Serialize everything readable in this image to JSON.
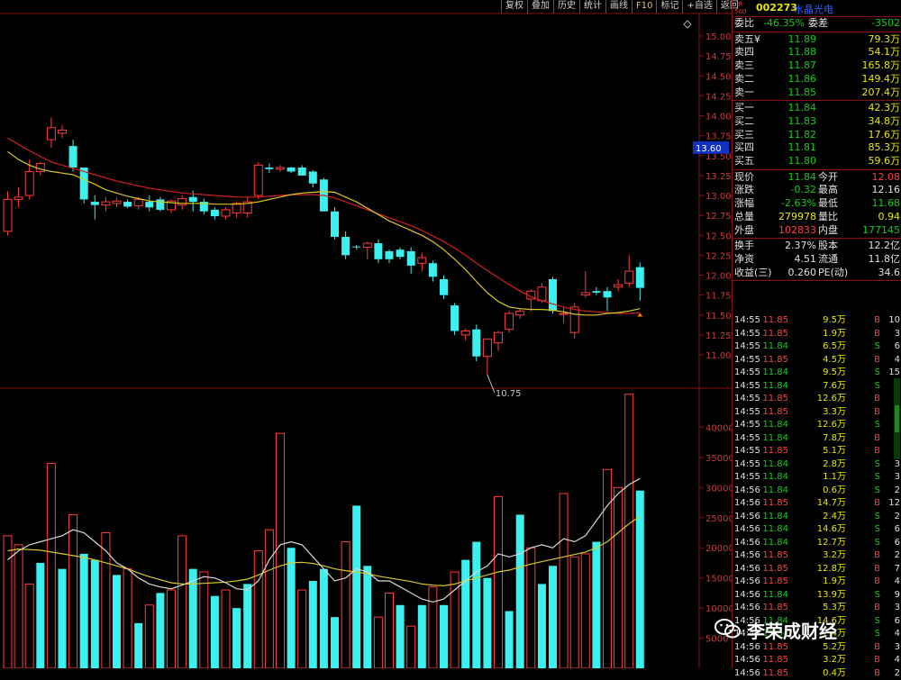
{
  "toolbar": {
    "items": [
      "复权",
      "叠加",
      "历史",
      "统计",
      "画线",
      "F10",
      "标记",
      "+自选",
      "返回"
    ]
  },
  "stock": {
    "code": "002273",
    "name": "水晶光电",
    "badge_top": "R",
    "badge_bottom": "500"
  },
  "price_axis": {
    "ticks": [
      "15.00",
      "14.75",
      "14.50",
      "14.25",
      "14.00",
      "13.75",
      "13.50",
      "13.25",
      "13.00",
      "12.75",
      "12.50",
      "12.25",
      "12.00",
      "11.75",
      "11.50",
      "11.25",
      "11.00"
    ],
    "marker": "13.60",
    "low_label": "10.75"
  },
  "volume_axis": {
    "ticks": [
      "40000",
      "35000",
      "30000",
      "25000",
      "20000",
      "15000",
      "10000",
      "5000"
    ]
  },
  "chart_data": [
    {
      "type": "candlestick",
      "title": "",
      "ylim": [
        10.6,
        15.15
      ],
      "ohlc": [
        [
          12.55,
          13.05,
          12.5,
          12.95
        ],
        [
          12.95,
          13.1,
          12.85,
          12.98
        ],
        [
          13.0,
          13.45,
          12.95,
          13.3
        ],
        [
          13.3,
          13.42,
          13.25,
          13.4
        ],
        [
          13.7,
          13.98,
          13.6,
          13.85
        ],
        [
          13.78,
          13.88,
          13.72,
          13.82
        ],
        [
          13.62,
          13.7,
          13.3,
          13.35
        ],
        [
          13.35,
          13.35,
          12.9,
          12.95
        ],
        [
          12.92,
          13.0,
          12.7,
          12.88
        ],
        [
          12.88,
          12.98,
          12.8,
          12.92
        ],
        [
          12.9,
          12.97,
          12.85,
          12.93
        ],
        [
          12.92,
          12.95,
          12.84,
          12.86
        ],
        [
          12.87,
          12.98,
          12.82,
          12.95
        ],
        [
          12.92,
          13.0,
          12.8,
          12.85
        ],
        [
          12.95,
          12.98,
          12.8,
          12.82
        ],
        [
          12.82,
          12.95,
          12.78,
          12.93
        ],
        [
          12.88,
          13.0,
          12.82,
          12.96
        ],
        [
          12.98,
          13.06,
          12.8,
          12.92
        ],
        [
          12.92,
          12.96,
          12.76,
          12.8
        ],
        [
          12.82,
          12.85,
          12.7,
          12.74
        ],
        [
          12.74,
          12.85,
          12.7,
          12.82
        ],
        [
          12.78,
          12.92,
          12.72,
          12.9
        ],
        [
          12.78,
          12.98,
          12.72,
          12.92
        ],
        [
          13.0,
          13.42,
          12.95,
          13.38
        ],
        [
          13.35,
          13.4,
          13.28,
          13.33
        ],
        [
          13.33,
          13.38,
          13.3,
          13.35
        ],
        [
          13.35,
          13.36,
          13.28,
          13.3
        ],
        [
          13.35,
          13.38,
          13.25,
          13.25
        ],
        [
          13.3,
          13.32,
          13.1,
          13.15
        ],
        [
          13.2,
          13.22,
          12.8,
          12.8
        ],
        [
          12.8,
          12.85,
          12.45,
          12.48
        ],
        [
          12.48,
          12.55,
          12.2,
          12.25
        ],
        [
          12.36,
          12.38,
          12.32,
          12.35
        ],
        [
          12.35,
          12.42,
          12.2,
          12.4
        ],
        [
          12.4,
          12.45,
          12.15,
          12.2
        ],
        [
          12.3,
          12.32,
          12.15,
          12.2
        ],
        [
          12.32,
          12.35,
          12.2,
          12.23
        ],
        [
          12.3,
          12.35,
          12.02,
          12.12
        ],
        [
          12.15,
          12.28,
          12.05,
          12.22
        ],
        [
          12.15,
          12.18,
          11.92,
          11.98
        ],
        [
          11.95,
          12.0,
          11.7,
          11.75
        ],
        [
          11.62,
          11.65,
          11.25,
          11.3
        ],
        [
          11.25,
          11.33,
          11.18,
          11.3
        ],
        [
          11.32,
          11.38,
          10.92,
          10.98
        ],
        [
          10.98,
          11.2,
          10.75,
          11.2
        ],
        [
          11.15,
          11.3,
          11.05,
          11.28
        ],
        [
          11.32,
          11.55,
          11.28,
          11.52
        ],
        [
          11.5,
          11.58,
          11.45,
          11.55
        ],
        [
          11.7,
          11.82,
          11.55,
          11.8
        ],
        [
          11.68,
          11.9,
          11.65,
          11.85
        ],
        [
          11.95,
          11.98,
          11.52,
          11.55
        ],
        [
          11.52,
          11.6,
          11.4,
          11.52
        ],
        [
          11.28,
          11.65,
          11.2,
          11.6
        ],
        [
          11.75,
          12.05,
          11.72,
          11.78
        ],
        [
          11.8,
          11.85,
          11.75,
          11.78
        ],
        [
          11.8,
          11.85,
          11.55,
          11.72
        ],
        [
          11.85,
          11.95,
          11.8,
          11.88
        ],
        [
          11.9,
          12.25,
          11.85,
          12.05
        ],
        [
          12.1,
          12.16,
          11.68,
          11.84
        ]
      ],
      "ma_short": [
        13.55,
        13.45,
        13.38,
        13.33,
        13.3,
        13.28,
        13.26,
        13.2,
        13.14,
        13.07,
        13.03,
        12.99,
        12.96,
        12.93,
        12.92,
        12.91,
        12.9,
        12.9,
        12.9,
        12.89,
        12.89,
        12.89,
        12.9,
        12.92,
        12.95,
        12.98,
        13.01,
        13.03,
        13.04,
        13.05,
        13.04,
        12.98,
        12.92,
        12.84,
        12.76,
        12.68,
        12.62,
        12.56,
        12.5,
        12.42,
        12.32,
        12.2,
        12.07,
        11.92,
        11.78,
        11.67,
        11.6,
        11.58,
        11.57,
        11.57,
        11.56,
        11.54,
        11.51,
        11.5,
        11.5,
        11.52,
        11.53,
        11.55,
        11.58
      ],
      "ma_long": [
        13.72,
        13.64,
        13.56,
        13.49,
        13.42,
        13.38,
        13.34,
        13.3,
        13.26,
        13.22,
        13.18,
        13.15,
        13.12,
        13.09,
        13.07,
        13.05,
        13.03,
        13.02,
        13.01,
        13.0,
        12.99,
        12.98,
        12.98,
        12.98,
        12.99,
        13.0,
        13.01,
        13.01,
        13.01,
        13.0,
        12.97,
        12.92,
        12.87,
        12.82,
        12.77,
        12.72,
        12.67,
        12.62,
        12.56,
        12.49,
        12.42,
        12.34,
        12.25,
        12.15,
        12.06,
        11.97,
        11.88,
        11.8,
        11.73,
        11.68,
        11.64,
        11.6,
        11.57,
        11.55,
        11.54,
        11.53,
        11.52,
        11.52,
        11.53
      ]
    },
    {
      "type": "bar",
      "title": "",
      "ylim": [
        0,
        45000
      ],
      "values": [
        22000,
        20500,
        14000,
        17500,
        34000,
        16500,
        25500,
        19000,
        18000,
        22500,
        15500,
        16500,
        7500,
        10500,
        12500,
        13000,
        22000,
        16500,
        16000,
        12000,
        13000,
        10000,
        14000,
        19500,
        23000,
        39000,
        20000,
        13000,
        14500,
        16500,
        8500,
        21000,
        27000,
        17000,
        8500,
        12500,
        10500,
        7000,
        10500,
        13500,
        10500,
        16000,
        18000,
        21000,
        15000,
        28500,
        9500,
        25500,
        20000,
        14000,
        17000,
        29000,
        18500,
        19000,
        21000,
        33000,
        30000,
        45500,
        29500
      ],
      "colors_up": [
        1,
        1,
        1,
        0,
        1,
        0,
        1,
        0,
        0,
        1,
        0,
        1,
        0,
        1,
        0,
        1,
        1,
        0,
        1,
        0,
        1,
        0,
        0,
        1,
        1,
        1,
        0,
        1,
        0,
        0,
        0,
        1,
        0,
        0,
        1,
        1,
        0,
        1,
        0,
        1,
        0,
        1,
        0,
        0,
        0,
        1,
        0,
        0,
        1,
        0,
        0,
        1,
        1,
        1,
        0,
        1,
        1,
        1,
        0
      ],
      "ma_white": [
        18000,
        19500,
        20500,
        21000,
        21500,
        22000,
        23000,
        22500,
        21000,
        19500,
        17500,
        16500,
        15000,
        14000,
        13500,
        13200,
        13800,
        14500,
        15200,
        15000,
        14200,
        13200,
        13000,
        14500,
        18000,
        20500,
        21000,
        20500,
        18500,
        16500,
        14500,
        15000,
        16500,
        16000,
        14500,
        14500,
        13500,
        12500,
        11500,
        11000,
        11500,
        13000,
        14500,
        16000,
        17000,
        19000,
        18500,
        19000,
        20000,
        20500,
        20000,
        21500,
        21000,
        22000,
        24500,
        27000,
        29000,
        30500,
        31500
      ],
      "ma_yellow": [
        19500,
        19800,
        19700,
        19600,
        19300,
        19000,
        18700,
        18400,
        18000,
        17500,
        17000,
        16500,
        15800,
        15200,
        14700,
        14200,
        14000,
        14000,
        14100,
        14200,
        14300,
        14500,
        14800,
        15500,
        16300,
        17000,
        17500,
        17600,
        17400,
        17000,
        16500,
        16200,
        16000,
        15700,
        15300,
        15000,
        14700,
        14400,
        14000,
        13800,
        13700,
        14000,
        14500,
        15000,
        15500,
        16000,
        16300,
        16800,
        17300,
        17700,
        18100,
        18500,
        18900,
        19300,
        20000,
        21000,
        22500,
        24000,
        25200
      ]
    }
  ],
  "panel": {
    "webi": {
      "label": "委比",
      "value": "-46.35%",
      "diff_label": "委差",
      "diff": "-3502"
    },
    "sell": [
      {
        "label": "卖五¥",
        "price": "11.89",
        "vol": "79.3万"
      },
      {
        "label": "卖四",
        "price": "11.88",
        "vol": "54.1万"
      },
      {
        "label": "卖三",
        "price": "11.87",
        "vol": "165.8万"
      },
      {
        "label": "卖二",
        "price": "11.86",
        "vol": "149.4万"
      },
      {
        "label": "卖一",
        "price": "11.85",
        "vol": "207.4万"
      }
    ],
    "buy": [
      {
        "label": "买一",
        "price": "11.84",
        "vol": "42.3万"
      },
      {
        "label": "买二",
        "price": "11.83",
        "vol": "34.8万"
      },
      {
        "label": "买三",
        "price": "11.82",
        "vol": "17.6万"
      },
      {
        "label": "买四",
        "price": "11.81",
        "vol": "85.3万"
      },
      {
        "label": "买五",
        "price": "11.80",
        "vol": "59.6万"
      }
    ],
    "stats": [
      {
        "l1": "现价",
        "v1": "11.84",
        "c1": "grn",
        "l2": "今开",
        "v2": "12.08",
        "c2": "red"
      },
      {
        "l1": "涨跌",
        "v1": "-0.32",
        "c1": "grn",
        "l2": "最高",
        "v2": "12.16",
        "c2": "wht"
      },
      {
        "l1": "涨幅",
        "v1": "-2.63%",
        "c1": "grn",
        "l2": "最低",
        "v2": "11.68",
        "c2": "grn"
      },
      {
        "l1": "总量",
        "v1": "279978",
        "c1": "yel",
        "l2": "量比",
        "v2": "0.94",
        "c2": "yel"
      },
      {
        "l1": "外盘",
        "v1": "102833",
        "c1": "red",
        "l2": "内盘",
        "v2": "177145",
        "c2": "grn"
      }
    ],
    "info": [
      {
        "l1": "换手",
        "v1": "2.37%",
        "l2": "股本",
        "v2": "12.2亿"
      },
      {
        "l1": "净资",
        "v1": "4.51",
        "l2": "流通",
        "v2": "11.8亿"
      },
      {
        "l1": "收益(三)",
        "v1": "0.260",
        "l2": "PE(动)",
        "v2": "34.6"
      }
    ],
    "ticks": [
      [
        "14:55",
        "11.85",
        "9.5万",
        "B",
        "10"
      ],
      [
        "14:55",
        "11.85",
        "1.9万",
        "B",
        "3"
      ],
      [
        "14:55",
        "11.84",
        "6.5万",
        "S",
        "6"
      ],
      [
        "14:55",
        "11.85",
        "4.5万",
        "B",
        "4"
      ],
      [
        "14:55",
        "11.84",
        "9.5万",
        "S",
        "15"
      ],
      [
        "14:55",
        "11.84",
        "7.6万",
        "S",
        "8"
      ],
      [
        "14:55",
        "11.85",
        "12.6万",
        "B",
        "4"
      ],
      [
        "14:55",
        "11.85",
        "3.3万",
        "B",
        "3"
      ],
      [
        "14:55",
        "11.84",
        "12.6万",
        "S",
        "6"
      ],
      [
        "14:55",
        "11.84",
        "7.8万",
        "B",
        "4"
      ],
      [
        "14:55",
        "11.85",
        "5.1万",
        "B",
        "5"
      ],
      [
        "14:55",
        "11.84",
        "2.8万",
        "S",
        "3"
      ],
      [
        "14:55",
        "11.84",
        "1.1万",
        "S",
        "3"
      ],
      [
        "14:56",
        "11.84",
        "0.6万",
        "S",
        "2"
      ],
      [
        "14:56",
        "11.85",
        "14.7万",
        "B",
        "12"
      ],
      [
        "14:56",
        "11.84",
        "2.4万",
        "S",
        "2"
      ],
      [
        "14:56",
        "11.84",
        "14.6万",
        "S",
        "6"
      ],
      [
        "14:56",
        "11.84",
        "12.7万",
        "S",
        "6"
      ],
      [
        "14:56",
        "11.85",
        "3.2万",
        "B",
        "2"
      ],
      [
        "14:56",
        "11.85",
        "12.8万",
        "B",
        "7"
      ],
      [
        "14:56",
        "11.85",
        "1.9万",
        "B",
        "4"
      ],
      [
        "14:56",
        "11.84",
        "13.9万",
        "S",
        "9"
      ],
      [
        "14:56",
        "11.85",
        "5.3万",
        "B",
        "3"
      ],
      [
        "14:56",
        "11.84",
        "14.6万",
        "S",
        "6"
      ],
      [
        "14:56",
        "11.84",
        "2.4万",
        "S",
        "4"
      ],
      [
        "14:56",
        "11.85",
        "5.2万",
        "B",
        "3"
      ],
      [
        "14:56",
        "11.85",
        "3.2万",
        "B",
        "4"
      ],
      [
        "14:56",
        "11.85",
        "0.4万",
        "B",
        "2"
      ]
    ]
  },
  "watermark": {
    "text": "李荣成财经"
  },
  "colors": {
    "up": "#ff3b3b",
    "down": "#3cf0f0",
    "ma_yellow": "#d8c820",
    "ma_red": "#d02020",
    "ma_white": "#d8d8d8",
    "grid": "#8a1010",
    "axis_text": "#c83c3c"
  }
}
